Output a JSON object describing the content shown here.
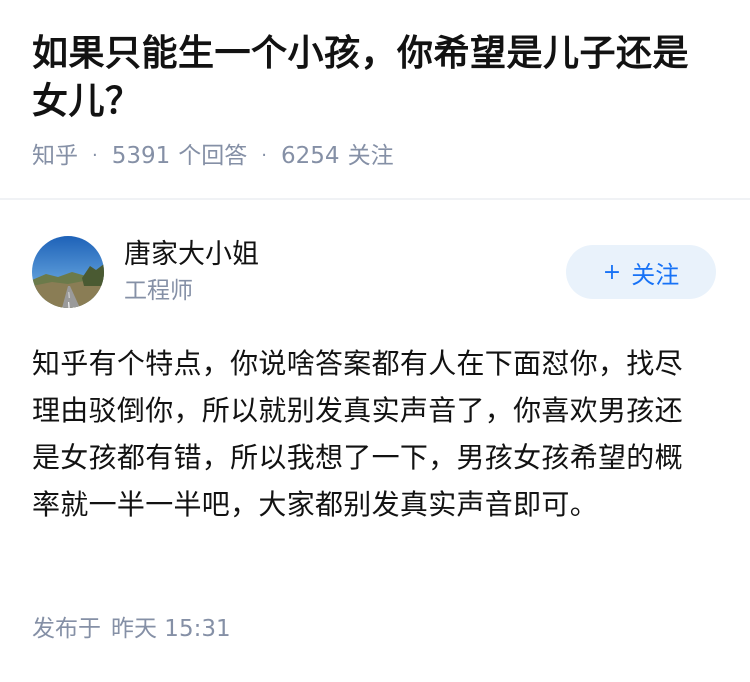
{
  "question": {
    "title": "如果只能生一个小孩，你希望是儿子还是女儿？",
    "source": "知乎",
    "answer_count": "5391",
    "answer_label": "个回答",
    "follow_count": "6254",
    "follow_label": "关注"
  },
  "answer": {
    "author_name": "唐家大小姐",
    "author_bio": "工程师",
    "follow_button": "关注",
    "content": "知乎有个特点，你说啥答案都有人在下面怼你，找尽理由驳倒你，所以就别发真实声音了，你喜欢男孩还是女孩都有错，所以我想了一下，男孩女孩希望的概率就一半一半吧，大家都别发真实声音即可。",
    "published_label": "发布于",
    "published_time": "昨天 15:31"
  },
  "colors": {
    "muted": "#8590a6",
    "accent": "#1772f6",
    "button_bg": "#e9f2fb"
  }
}
